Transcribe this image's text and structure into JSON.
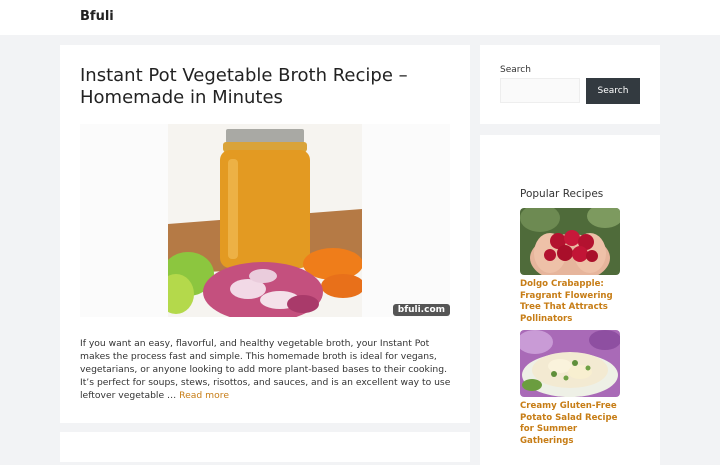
{
  "site": {
    "title": "Bfuli"
  },
  "article": {
    "title": "Instant Pot Vegetable Broth Recipe – Homemade in Minutes",
    "watermark": "bfuli.com",
    "excerpt": "If you want an easy, flavorful, and healthy vegetable broth, your Instant Pot makes the process fast and simple. This homemade broth is ideal for vegans, vegetarians, or anyone looking to add more plant-based bases to their cooking. It’s perfect for soups, stews, risottos, and sauces, and is an excellent way to use leftover vegetable … ",
    "read_more": "Read more"
  },
  "sidebar": {
    "search": {
      "label": "Search",
      "button": "Search",
      "placeholder": ""
    },
    "popular": {
      "title": "Popular Recipes",
      "items": [
        {
          "title": "Dolgo Crabapple: Fragrant Flowering Tree That Attracts Pollinators"
        },
        {
          "title": "Creamy Gluten-Free Potato Salad Recipe for Summer Gatherings"
        }
      ]
    }
  },
  "colors": {
    "accent": "#c77d16",
    "button": "#333a40",
    "background": "#f2f3f5"
  }
}
